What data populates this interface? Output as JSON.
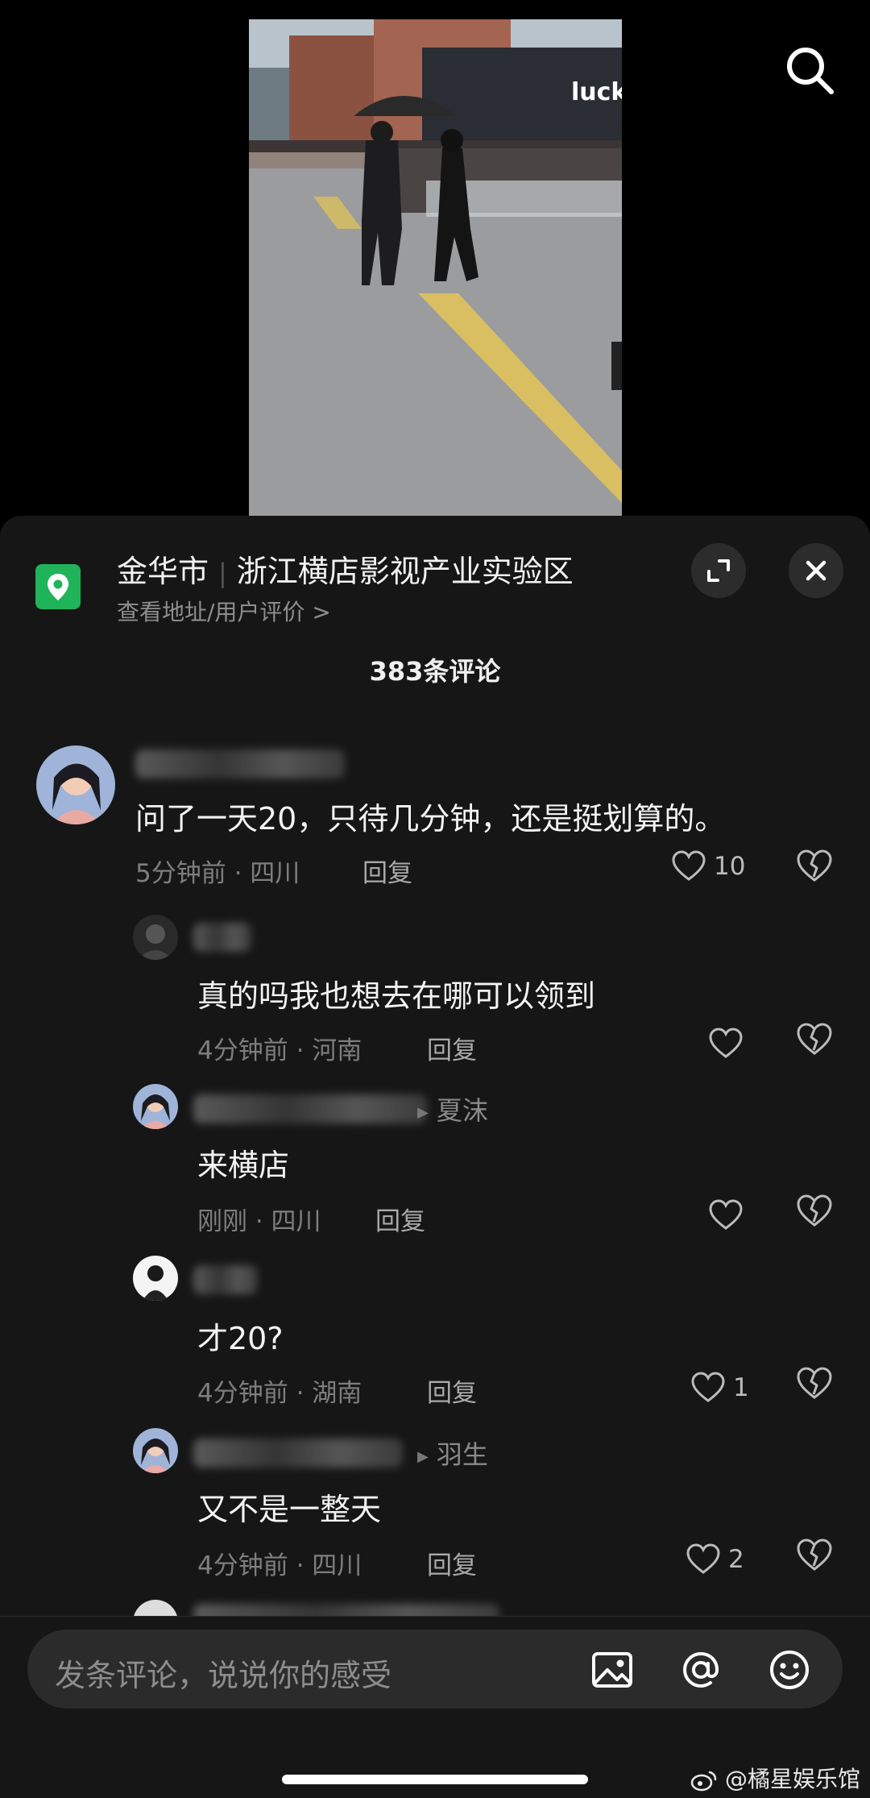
{
  "video": {
    "storefront_sign": "luckin c"
  },
  "location": {
    "city": "金华市",
    "place": "浙江横店影视产业实验区",
    "subtitle": "查看地址/用户评价 >"
  },
  "comments_header": {
    "count_label": "383条评论"
  },
  "comments": [
    {
      "text": "问了一天20，只待几分钟，还是挺划算的。",
      "time_location": "5分钟前 · 四川",
      "reply_label": "回复",
      "like_count": "10"
    },
    {
      "text": "真的吗我也想去在哪可以领到",
      "time_location": "4分钟前 · 河南",
      "reply_label": "回复",
      "like_count": ""
    },
    {
      "reply_to": "夏沫",
      "text": "来横店",
      "time_location": "刚刚 · 四川",
      "reply_label": "回复",
      "like_count": ""
    },
    {
      "text": "才20?",
      "time_location": "4分钟前 · 湖南",
      "reply_label": "回复",
      "like_count": "1"
    },
    {
      "reply_to": "羽生",
      "text": "又不是一整天",
      "time_location": "4分钟前 · 四川",
      "reply_label": "回复",
      "like_count": "2"
    }
  ],
  "input_bar": {
    "placeholder": "发条评论，说说你的感受"
  },
  "watermark": "@橘星娱乐馆",
  "colors": {
    "sheet_bg": "#161616",
    "location_icon": "#20b45a",
    "input_bg": "#2b2b2b"
  },
  "icons": [
    "search-icon",
    "location-pin-icon",
    "expand-icon",
    "close-icon",
    "heart-icon",
    "broken-heart-icon",
    "image-icon",
    "at-icon",
    "emoji-icon",
    "weibo-icon"
  ]
}
